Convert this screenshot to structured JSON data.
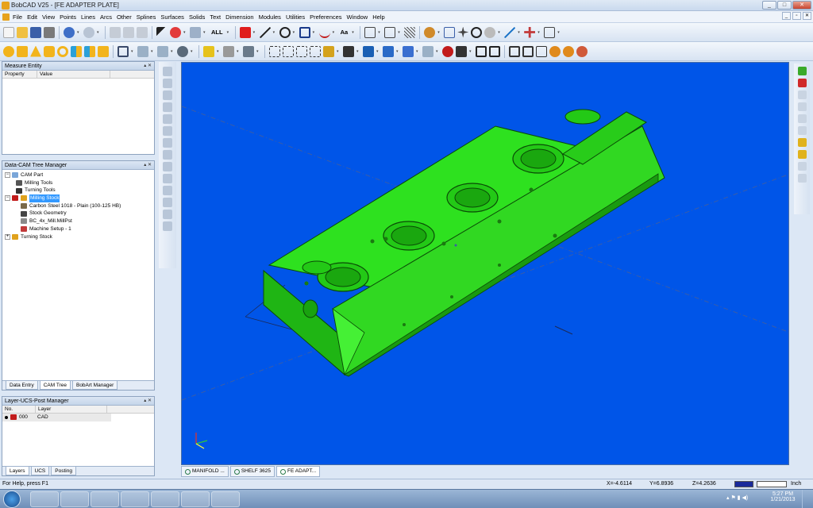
{
  "window": {
    "title": "BobCAD V25 - [FE ADAPTER PLATE]",
    "min": "_",
    "max": "□",
    "close": "✕"
  },
  "mdi": {
    "min": "_",
    "restore": "▫",
    "close": "✕"
  },
  "menu": [
    "File",
    "Edit",
    "View",
    "Points",
    "Lines",
    "Arcs",
    "Other",
    "Splines",
    "Surfaces",
    "Solids",
    "Text",
    "Dimension",
    "Modules",
    "Utilities",
    "Preferences",
    "Window",
    "Help"
  ],
  "toolbar": {
    "select_all": "ALL",
    "text_style": "Aa"
  },
  "measure_panel": {
    "title": "Measure Entity",
    "col_property": "Property",
    "col_value": "Value"
  },
  "cam_tree": {
    "title": "Data-CAM Tree Manager",
    "items": [
      "CAM Part",
      "Milling Tools",
      "Turning Tools",
      "Milling Stock",
      "Carbon Steel 1018 - Plain (100-125 HB)",
      "Stock Geometry",
      "BC_4x_Mill.MillPst",
      "Machine Setup - 1",
      "Turning Stock"
    ],
    "tabs": [
      "Data Entry",
      "CAM Tree",
      "BobArt Manager"
    ]
  },
  "layer_panel": {
    "title": "Layer-UCS-Post Manager",
    "col_no": "No.",
    "col_layer": "Layer",
    "row_no": "000",
    "row_layer": "CAD",
    "tabs": [
      "Layers",
      "UCS",
      "Posting"
    ]
  },
  "doc_tabs": [
    "MANIFOLD ...",
    "SHELF 3625",
    "FE ADAPT..."
  ],
  "status": {
    "help": "For Help, press F1",
    "x": "X=-4.6114",
    "y": "Y=6.8936",
    "z": "Z=4.2636",
    "unit": "Inch"
  },
  "taskbar": {
    "time": "5:27 PM",
    "date": "1/21/2013"
  },
  "colors": {
    "viewport": "#0055e8",
    "model": "#22dd11"
  }
}
